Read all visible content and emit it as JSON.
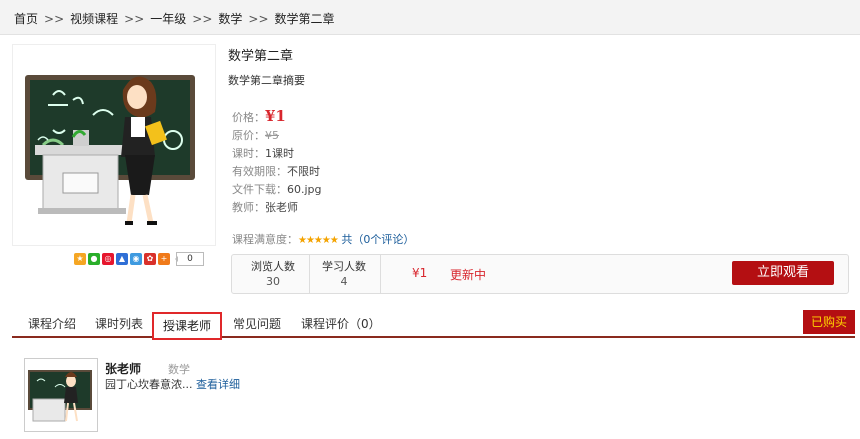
{
  "breadcrumb": {
    "home": "首页",
    "sep": ">>",
    "items": [
      "视频课程",
      "一年级",
      "数学",
      "数学第二章"
    ]
  },
  "course": {
    "title": "数学第二章",
    "summary": "数学第二章摘要",
    "price_label": "价格：",
    "price": "¥1",
    "original_label": "原价：",
    "original_price": "¥5",
    "hours_label": "课时：",
    "hours": "1课时",
    "validity_label": "有效期限：",
    "validity": "不限时",
    "download_label": "文件下载：",
    "download": "60.jpg",
    "teacher_label": "教师：",
    "teacher": "张老师",
    "rating_label": "课程满意度：",
    "rating_stars": "★★★★★",
    "comments_link": "共（0个评论）"
  },
  "share": {
    "count": "0",
    "icons": [
      "qzone-icon",
      "wechat-icon",
      "weibo-icon",
      "baidu-icon",
      "tencent-weibo-icon",
      "renren-icon",
      "more-share-icon"
    ]
  },
  "stats": {
    "views_label": "浏览人数",
    "views": "30",
    "learners_label": "学习人数",
    "learners": "4",
    "price": "¥1",
    "status": "更新中",
    "watch_button": "立即观看"
  },
  "tabs": {
    "items": [
      "课程介绍",
      "课时列表",
      "授课老师",
      "常见问题",
      "课程评价（0）"
    ],
    "active": "授课老师",
    "bought": "已购买"
  },
  "teacher_panel": {
    "name": "张老师",
    "subject": "数学",
    "bio": "园丁心坎春意浓...",
    "more_link": "查看详细"
  },
  "colors": {
    "accent_red": "#b40f12",
    "price_red": "#d8262d",
    "link_blue": "#1a5c9a",
    "star_gold": "#f4a300"
  }
}
